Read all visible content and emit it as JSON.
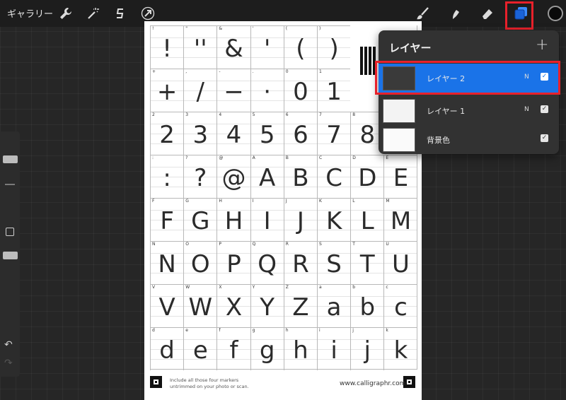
{
  "toolbar": {
    "gallery_label": "ギャラリー",
    "icons": [
      "wrench-icon",
      "magic-wand-icon",
      "selection-icon",
      "transform-arrow-icon",
      "brush-icon",
      "smudge-icon",
      "eraser-icon",
      "layers-icon"
    ],
    "current_color": "#0a0a0a"
  },
  "layers_panel": {
    "title": "レイヤー",
    "add_label": "+",
    "layers": [
      {
        "name": "レイヤー 2",
        "blend": "N",
        "visible": true,
        "selected": true
      },
      {
        "name": "レイヤー 1",
        "blend": "N",
        "visible": true,
        "selected": false
      },
      {
        "name": "背景色",
        "blend": "",
        "visible": true,
        "selected": false
      }
    ]
  },
  "sheet": {
    "rows": [
      [
        {
          "label": "!",
          "glyph": "!"
        },
        {
          "label": "\"",
          "glyph": "''"
        },
        {
          "label": "&",
          "glyph": "&"
        },
        {
          "label": "'",
          "glyph": "'"
        },
        {
          "label": "(",
          "glyph": "("
        },
        {
          "label": ")",
          "glyph": ")"
        }
      ],
      [
        {
          "label": "+",
          "glyph": "+"
        },
        {
          "label": ",",
          "glyph": "/"
        },
        {
          "label": "-",
          "glyph": "−"
        },
        {
          "label": ".",
          "glyph": "·"
        },
        {
          "label": "0",
          "glyph": "0"
        },
        {
          "label": "1",
          "glyph": "1"
        }
      ],
      [
        {
          "label": "2",
          "glyph": "2"
        },
        {
          "label": "3",
          "glyph": "3"
        },
        {
          "label": "4",
          "glyph": "4"
        },
        {
          "label": "5",
          "glyph": "5"
        },
        {
          "label": "6",
          "glyph": "6"
        },
        {
          "label": "7",
          "glyph": "7"
        },
        {
          "label": "8",
          "glyph": "8"
        }
      ],
      [
        {
          "label": ":",
          "glyph": ":"
        },
        {
          "label": "?",
          "glyph": "?"
        },
        {
          "label": "@",
          "glyph": "@"
        },
        {
          "label": "A",
          "glyph": "A"
        },
        {
          "label": "B",
          "glyph": "B"
        },
        {
          "label": "C",
          "glyph": "C"
        },
        {
          "label": "D",
          "glyph": "D"
        },
        {
          "label": "E",
          "glyph": "E"
        }
      ],
      [
        {
          "label": "F",
          "glyph": "F"
        },
        {
          "label": "G",
          "glyph": "G"
        },
        {
          "label": "H",
          "glyph": "H"
        },
        {
          "label": "I",
          "glyph": "I"
        },
        {
          "label": "J",
          "glyph": "J"
        },
        {
          "label": "K",
          "glyph": "K"
        },
        {
          "label": "L",
          "glyph": "L"
        },
        {
          "label": "M",
          "glyph": "M"
        }
      ],
      [
        {
          "label": "N",
          "glyph": "N"
        },
        {
          "label": "O",
          "glyph": "O"
        },
        {
          "label": "P",
          "glyph": "P"
        },
        {
          "label": "Q",
          "glyph": "Q"
        },
        {
          "label": "R",
          "glyph": "R"
        },
        {
          "label": "S",
          "glyph": "S"
        },
        {
          "label": "T",
          "glyph": "T"
        },
        {
          "label": "U",
          "glyph": "U"
        }
      ],
      [
        {
          "label": "V",
          "glyph": "V"
        },
        {
          "label": "W",
          "glyph": "W"
        },
        {
          "label": "X",
          "glyph": "X"
        },
        {
          "label": "Y",
          "glyph": "Y"
        },
        {
          "label": "Z",
          "glyph": "Z"
        },
        {
          "label": "a",
          "glyph": "a"
        },
        {
          "label": "b",
          "glyph": "b"
        },
        {
          "label": "c",
          "glyph": "c"
        }
      ],
      [
        {
          "label": "d",
          "glyph": "d"
        },
        {
          "label": "e",
          "glyph": "e"
        },
        {
          "label": "f",
          "glyph": "f"
        },
        {
          "label": "g",
          "glyph": "g"
        },
        {
          "label": "h",
          "glyph": "h"
        },
        {
          "label": "i",
          "glyph": "i"
        },
        {
          "label": "j",
          "glyph": "j"
        },
        {
          "label": "k",
          "glyph": "k"
        }
      ]
    ],
    "footnote_line1": "Include all those four markers",
    "footnote_line2": "untrimmed on your photo or scan.",
    "website": "www.calligraphr.com"
  },
  "highlight_color": "#e8212b",
  "accent_color": "#1a73e8"
}
